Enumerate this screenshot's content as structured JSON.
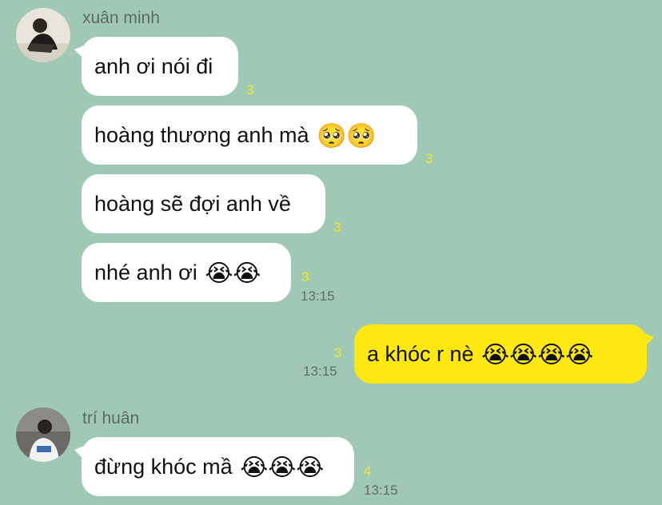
{
  "conversation": {
    "group1": {
      "sender": "xuân minh",
      "messages": [
        {
          "text": "anh ơi nói đi",
          "emojis": "",
          "count": "3",
          "time": ""
        },
        {
          "text": "hoàng thương anh mà",
          "emojis": "🥺🥺",
          "count": "3",
          "time": ""
        },
        {
          "text": "hoàng sẽ đợi anh về",
          "emojis": "",
          "count": "3",
          "time": ""
        },
        {
          "text": "nhé anh ơi",
          "emojis": "😭😭",
          "count": "3",
          "time": "13:15"
        }
      ]
    },
    "mine": {
      "text": "a khóc r nè",
      "emojis": "😭😭😭😭",
      "count": "3",
      "time": "13:15"
    },
    "group2": {
      "sender": "trí huân",
      "messages": [
        {
          "text": "đừng khóc mầ",
          "emojis": "😭😭😭",
          "count": "4",
          "time": "13:15"
        }
      ]
    }
  },
  "colors": {
    "background": "#9fc8b5",
    "incoming_bubble": "#ffffff",
    "outgoing_bubble": "#ffe812",
    "unread_count": "#f4e81c"
  }
}
